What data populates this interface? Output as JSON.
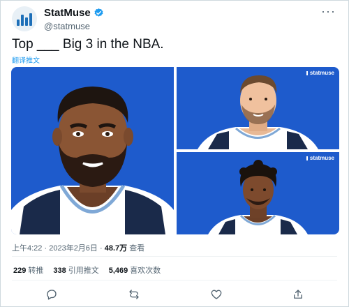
{
  "author": {
    "name": "StatMuse",
    "handle": "@statmuse",
    "avatar": "statmuse-logo",
    "verified": true
  },
  "tweet": {
    "text": "Top ___ Big 3 in the NBA.",
    "translate_label": "翻译推文"
  },
  "media": {
    "watermark": "statmuse",
    "background_color": "#1e5bcc",
    "images": [
      "player-portrait-large",
      "player-portrait-top-right",
      "player-portrait-bottom-right"
    ]
  },
  "meta": {
    "time": "上午4:22",
    "date": "2023年2月6日",
    "views": "48.7万",
    "views_label": "查看"
  },
  "stats": [
    {
      "value": "229",
      "label": "转推"
    },
    {
      "value": "338",
      "label": "引用推文"
    },
    {
      "value": "5,469",
      "label": "喜欢次数"
    }
  ],
  "actions": [
    "reply-icon",
    "retweet-icon",
    "like-icon",
    "share-icon"
  ],
  "colors": {
    "accent": "#1d9bf0",
    "text": "#0f1419",
    "muted": "#536471"
  }
}
